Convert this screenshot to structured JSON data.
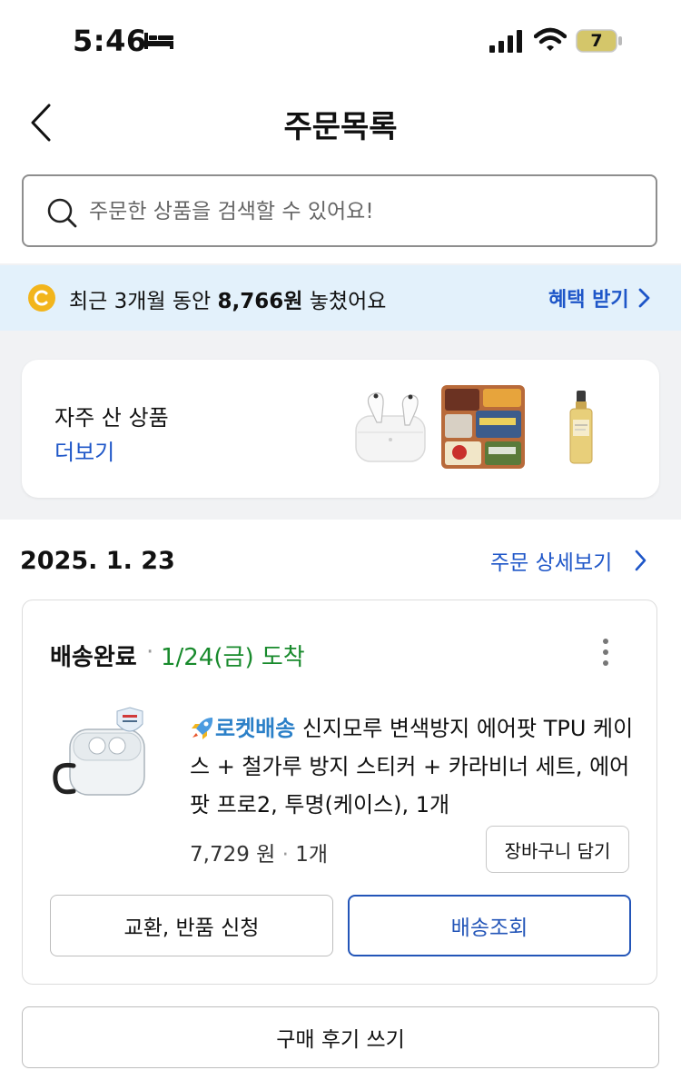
{
  "status_bar": {
    "time": "5:46",
    "battery": "7"
  },
  "header": {
    "title": "주문목록"
  },
  "search": {
    "placeholder": "주문한 상품을 검색할 수 있어요!"
  },
  "benefit": {
    "prefix": "최근 3개월 동안 ",
    "amount": "8,766원",
    "suffix": " 놓쳤어요",
    "link": "혜택 받기"
  },
  "frequent": {
    "title": "자주 산 상품",
    "more": "더보기",
    "items": [
      "airpods-pro",
      "snack-box",
      "serum-bottle"
    ]
  },
  "order": {
    "date": "2025. 1. 23",
    "detail_link": "주문 상세보기",
    "status": "배송완료",
    "dot": "·",
    "arrival": "1/24(금) 도착",
    "rocket": "로켓배송",
    "product_name": " 신지모루 변색방지 에어팟 TPU 케이스 + 철가루 방지 스티커 + 카라비너 세트, 에어팟 프로2, 투명(케이스), 1개",
    "price": "7,729 원",
    "qty": "1개",
    "cart_label": "장바구니 담기",
    "return_label": "교환, 반품 신청",
    "track_label": "배송조회"
  },
  "review": {
    "label": "구매 후기 쓰기"
  },
  "colors": {
    "accent_blue": "#1e56c8",
    "arrival_green": "#188a2c",
    "benefit_bg": "#e3f1fb",
    "rocket_blue": "#2b80c8"
  }
}
